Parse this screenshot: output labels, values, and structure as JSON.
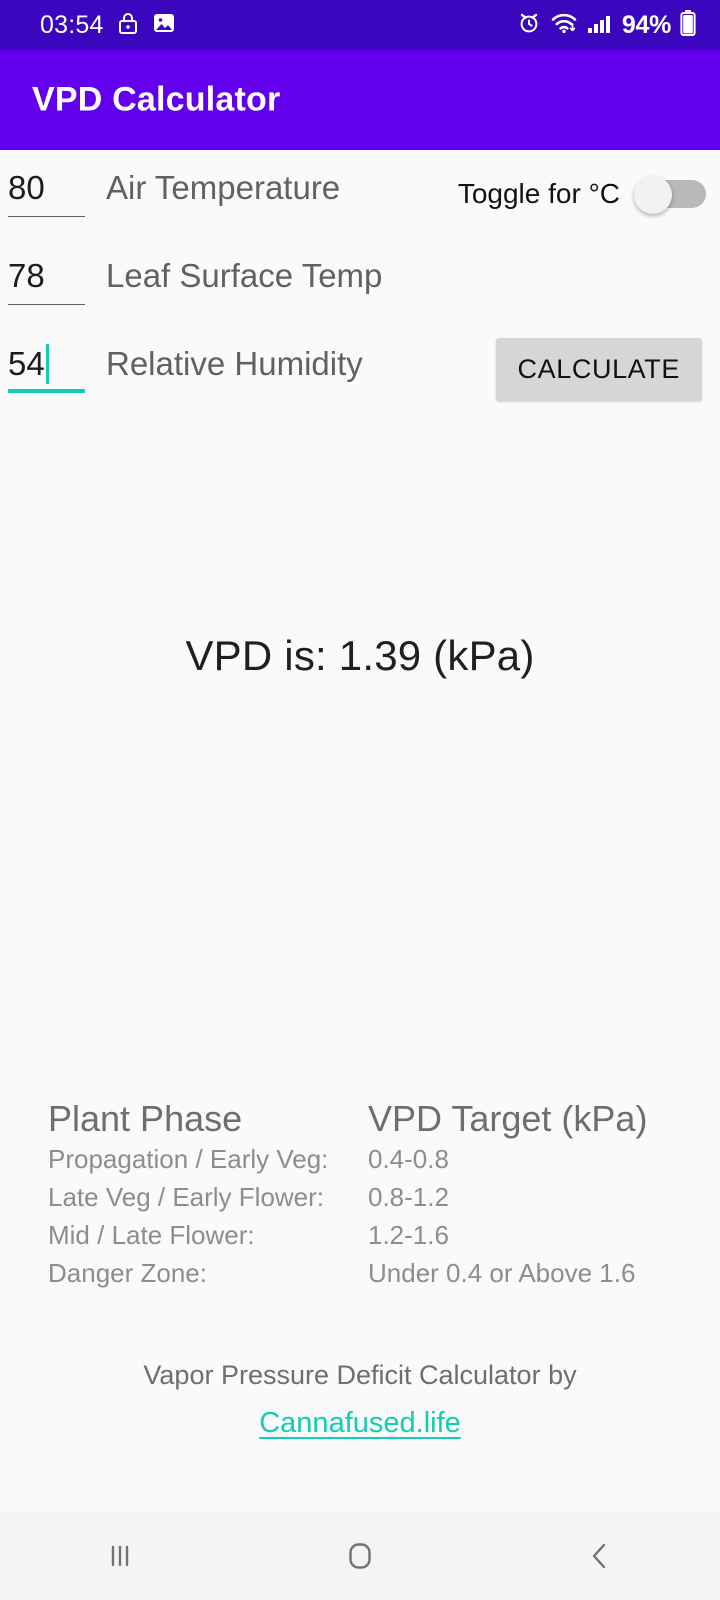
{
  "status_bar": {
    "time": "03:54",
    "battery_percent": "94%",
    "icons": [
      "lock-icon",
      "image-icon",
      "alarm-icon",
      "wifi-icon",
      "signal-icon",
      "battery-icon"
    ]
  },
  "app_bar": {
    "title": "VPD Calculator",
    "background": "#6200ee"
  },
  "form": {
    "fields": [
      {
        "value": "80",
        "label": "Air Temperature",
        "focused": false
      },
      {
        "value": "78",
        "label": "Leaf Surface Temp",
        "focused": false
      },
      {
        "value": "54",
        "label": "Relative Humidity",
        "focused": true
      }
    ],
    "toggle": {
      "label": "Toggle for °C",
      "checked": false
    },
    "calculate_label": "CALCULATE"
  },
  "result": {
    "text": "VPD is: 1.39 (kPa)",
    "value": "1.39",
    "unit": "kPa"
  },
  "reference": {
    "headers": [
      "Plant Phase",
      "VPD Target (kPa)"
    ],
    "rows": [
      {
        "phase": "Propagation / Early Veg:",
        "target": "0.4-0.8"
      },
      {
        "phase": "Late Veg / Early Flower:",
        "target": "0.8-1.2"
      },
      {
        "phase": "Mid / Late Flower:",
        "target": "1.2-1.6"
      },
      {
        "phase": "Danger Zone:",
        "target": "Under 0.4 or Above 1.6"
      }
    ]
  },
  "footer": {
    "text": "Vapor Pressure Deficit Calculator by",
    "link": "Cannafused.life"
  },
  "nav_bar": {
    "recents": "recents-icon",
    "home": "home-icon",
    "back": "back-icon"
  },
  "colors": {
    "accent": "#14ccb4",
    "primary": "#6200ee",
    "status_bar": "#3a07be"
  }
}
